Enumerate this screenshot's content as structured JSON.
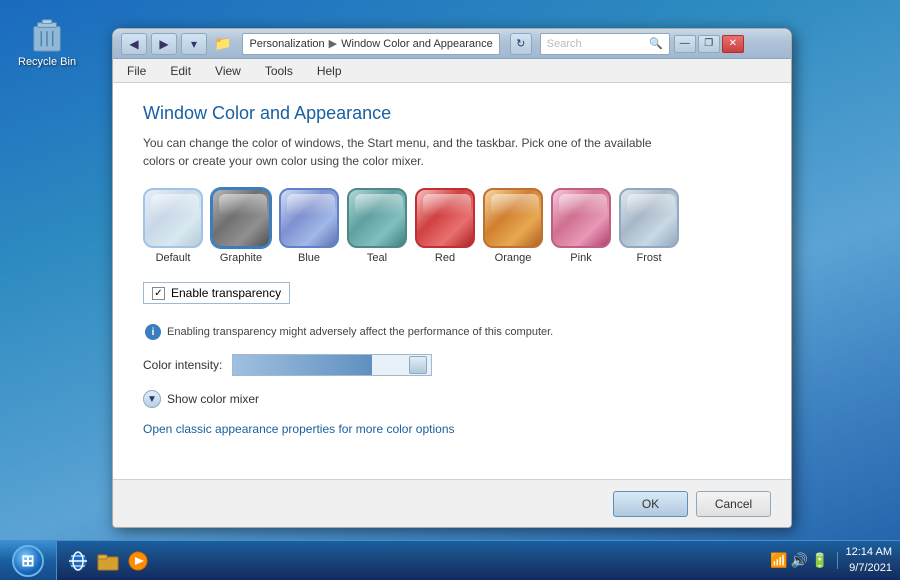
{
  "desktop": {
    "recycle_bin_label": "Recycle Bin"
  },
  "title_bar": {
    "back_label": "◀",
    "forward_label": "▶",
    "dropdown_label": "▾",
    "address_part1": "Personalization",
    "address_part2": "Window Color and Appearance",
    "refresh_label": "↻",
    "search_placeholder": "Search",
    "search_icon": "🔍",
    "minimize_label": "—",
    "restore_label": "❐",
    "close_label": "✕"
  },
  "menu": {
    "items": [
      "File",
      "Edit",
      "View",
      "Tools",
      "Help"
    ]
  },
  "content": {
    "page_title": "Window Color and Appearance",
    "description": "You can change the color of windows, the Start menu, and the taskbar. Pick one of the available colors or create your own color using the color mixer.",
    "swatches": [
      {
        "id": "default",
        "label": "Default",
        "selected": false
      },
      {
        "id": "graphite",
        "label": "Graphite",
        "selected": true
      },
      {
        "id": "blue",
        "label": "Blue",
        "selected": false
      },
      {
        "id": "teal",
        "label": "Teal",
        "selected": false
      },
      {
        "id": "red",
        "label": "Red",
        "selected": false
      },
      {
        "id": "orange",
        "label": "Orange",
        "selected": false
      },
      {
        "id": "pink",
        "label": "Pink",
        "selected": false
      },
      {
        "id": "frost",
        "label": "Frost",
        "selected": false
      }
    ],
    "enable_transparency_label": "Enable transparency",
    "transparency_note": "Enabling transparency might adversely affect the performance of this computer.",
    "color_intensity_label": "Color intensity:",
    "show_color_mixer_label": "Show color mixer",
    "classic_link": "Open classic appearance properties for more color options"
  },
  "footer": {
    "ok_label": "OK",
    "cancel_label": "Cancel"
  },
  "taskbar": {
    "time": "12:14 AM",
    "date": "9/7/2021"
  }
}
